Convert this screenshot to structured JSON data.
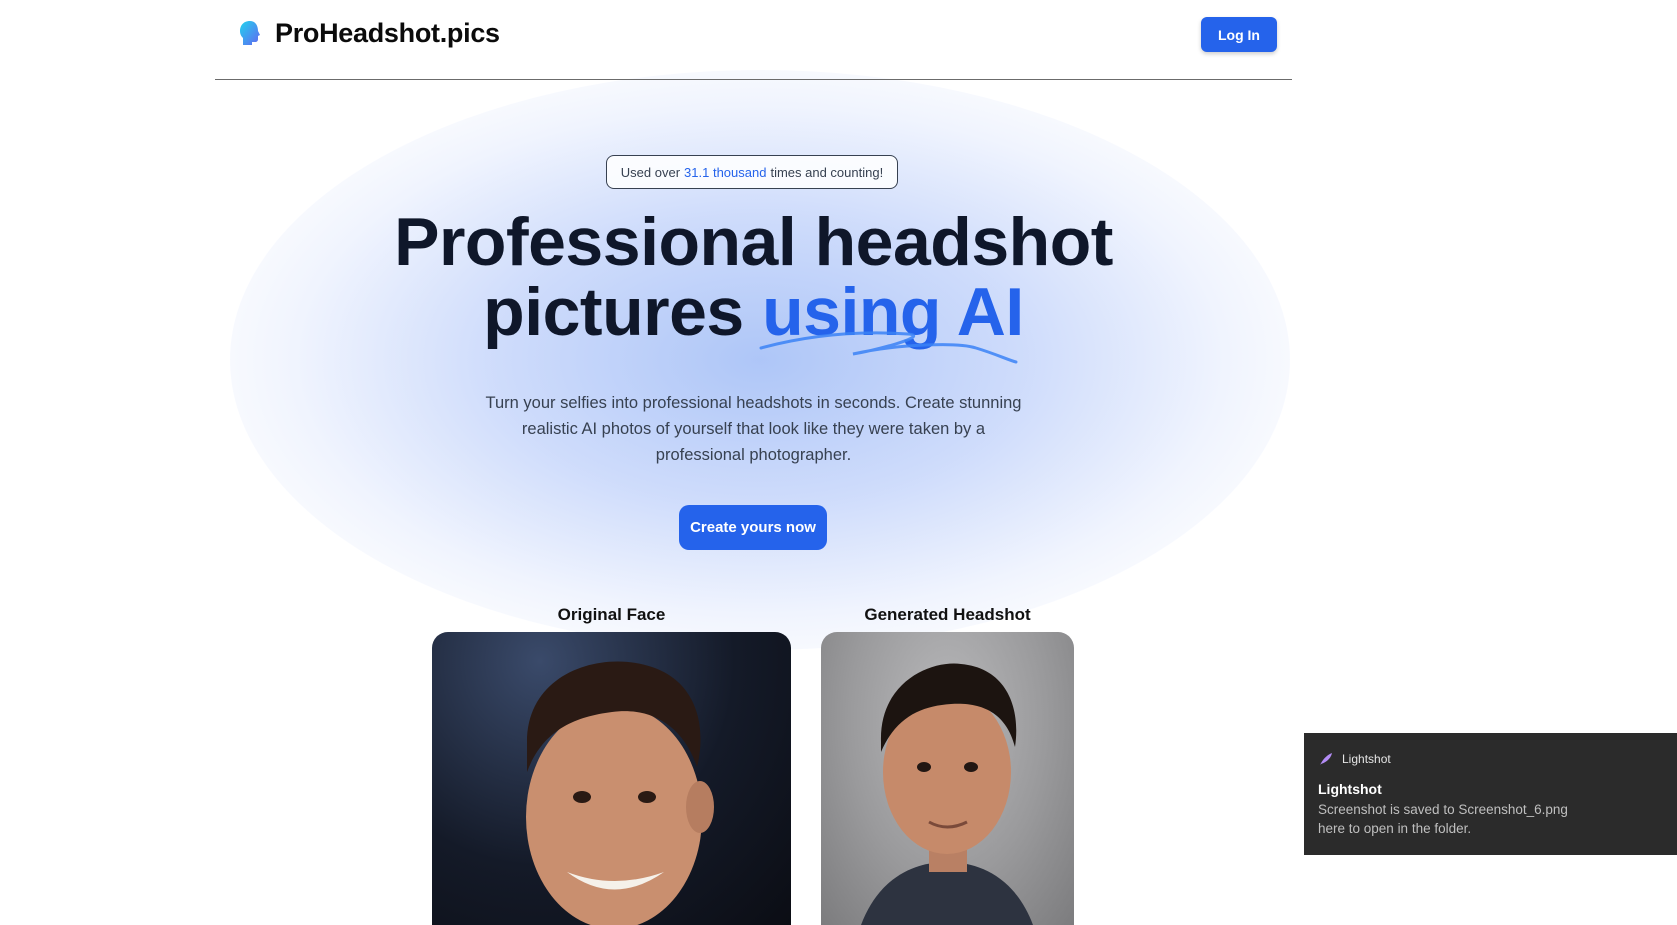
{
  "header": {
    "brand": "ProHeadshot.pics",
    "login_label": "Log In"
  },
  "hero": {
    "badge_prefix": "Used over",
    "badge_count": "31.1 thousand",
    "badge_suffix": "times and counting!",
    "title_line1": "Professional headshot",
    "title_line2_plain": "pictures",
    "title_line2_accent": "using AI",
    "subtitle": "Turn your selfies into professional headshots in seconds. Create stunning realistic AI photos of yourself that look like they were taken by a professional photographer.",
    "cta_label": "Create yours now"
  },
  "comparison": {
    "original_label": "Original Face",
    "generated_label": "Generated Headshot"
  },
  "toast": {
    "app_name": "Lightshot",
    "title": "Lightshot",
    "message_line1": "Screenshot is saved to Screenshot_6.png",
    "message_line2": "here to open in the folder."
  },
  "colors": {
    "accent": "#2563eb",
    "heading": "#0f172a",
    "toast_bg": "#2b2b2b"
  },
  "icons": {
    "logo": "head-silhouette-icon",
    "toast": "feather-icon"
  }
}
